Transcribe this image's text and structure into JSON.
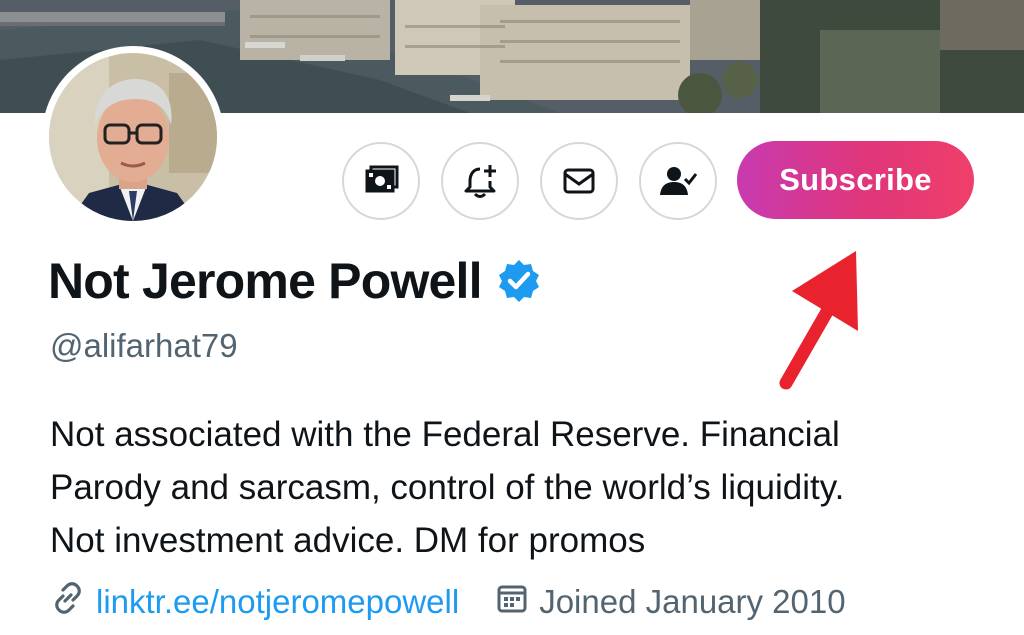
{
  "profile": {
    "display_name": "Not Jerome Powell",
    "handle": "@alifarhat79",
    "verified": true,
    "bio_lines": [
      "Not associated with the Federal Reserve. Financial",
      "Parody and sarcasm, control of the world’s liquidity.",
      "Not investment advice. DM for promos"
    ],
    "link": "linktr.ee/notjeromepowell",
    "joined": "Joined January 2010"
  },
  "actions": {
    "tip_icon": "money-icon",
    "notify_icon": "bell-plus-icon",
    "message_icon": "mail-icon",
    "following_icon": "person-check-icon",
    "subscribe_label": "Subscribe"
  },
  "colors": {
    "link": "#1d9bf0",
    "secondary_text": "#536471",
    "verified_badge": "#1d9bf0",
    "subscribe_gradient_start": "#c83ab0",
    "subscribe_gradient_end": "#ef3f6a",
    "arrow": "#e8232d"
  }
}
